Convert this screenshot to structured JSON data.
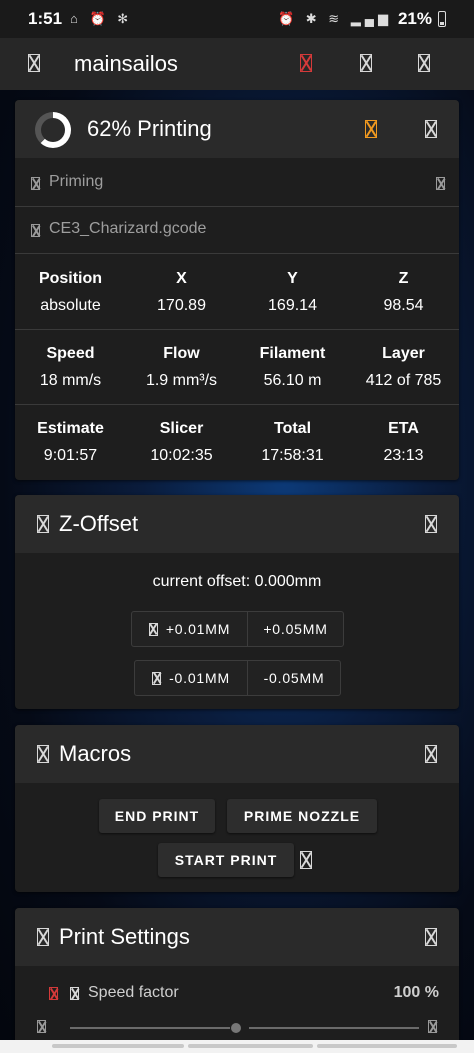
{
  "status_bar": {
    "time": "1:51",
    "left_icons": "⌂ ⏰ ✻",
    "right_icons": "⏰ ✱ ≋ ▂▄▆",
    "battery": "21%"
  },
  "app_bar": {
    "title": "mainsailos",
    "icons": [
      "menu-icon",
      "emergency-stop-icon",
      "upload-icon",
      "power-icon"
    ]
  },
  "status_card": {
    "title": "62% Printing",
    "progress": 0.62,
    "state_message": "Priming",
    "filename": "CE3_Charizard.gcode",
    "rows": [
      {
        "cells": [
          {
            "label": "Position",
            "value": "absolute"
          },
          {
            "label": "X",
            "value": "170.89"
          },
          {
            "label": "Y",
            "value": "169.14"
          },
          {
            "label": "Z",
            "value": "98.54"
          }
        ]
      },
      {
        "cells": [
          {
            "label": "Speed",
            "value": "18 mm/s"
          },
          {
            "label": "Flow",
            "value": "1.9 mm³/s"
          },
          {
            "label": "Filament",
            "value": "56.10 m"
          },
          {
            "label": "Layer",
            "value": "412 of 785"
          }
        ]
      },
      {
        "cells": [
          {
            "label": "Estimate",
            "value": "9:01:57"
          },
          {
            "label": "Slicer",
            "value": "10:02:35"
          },
          {
            "label": "Total",
            "value": "17:58:31"
          },
          {
            "label": "ETA",
            "value": "23:13"
          }
        ]
      }
    ]
  },
  "zoffset_card": {
    "title": "Z-Offset",
    "current_offset": "current offset: 0.000mm",
    "buttons": {
      "up_small": "+0.01MM",
      "up_large": "+0.05MM",
      "down_small": "-0.01MM",
      "down_large": "-0.05MM"
    }
  },
  "macros_card": {
    "title": "Macros",
    "buttons": [
      "END PRINT",
      "PRIME NOZZLE",
      "START PRINT"
    ]
  },
  "print_settings_card": {
    "title": "Print Settings",
    "speed_factor_label": "Speed factor",
    "speed_factor_value": "100 %",
    "speed_factor_level": 1.0
  },
  "colors": {
    "accent_red": "#d43a3a",
    "accent_orange": "#f29a1f",
    "card_bg": "#1e1e1e",
    "card_header_bg": "#2a2a2a"
  }
}
